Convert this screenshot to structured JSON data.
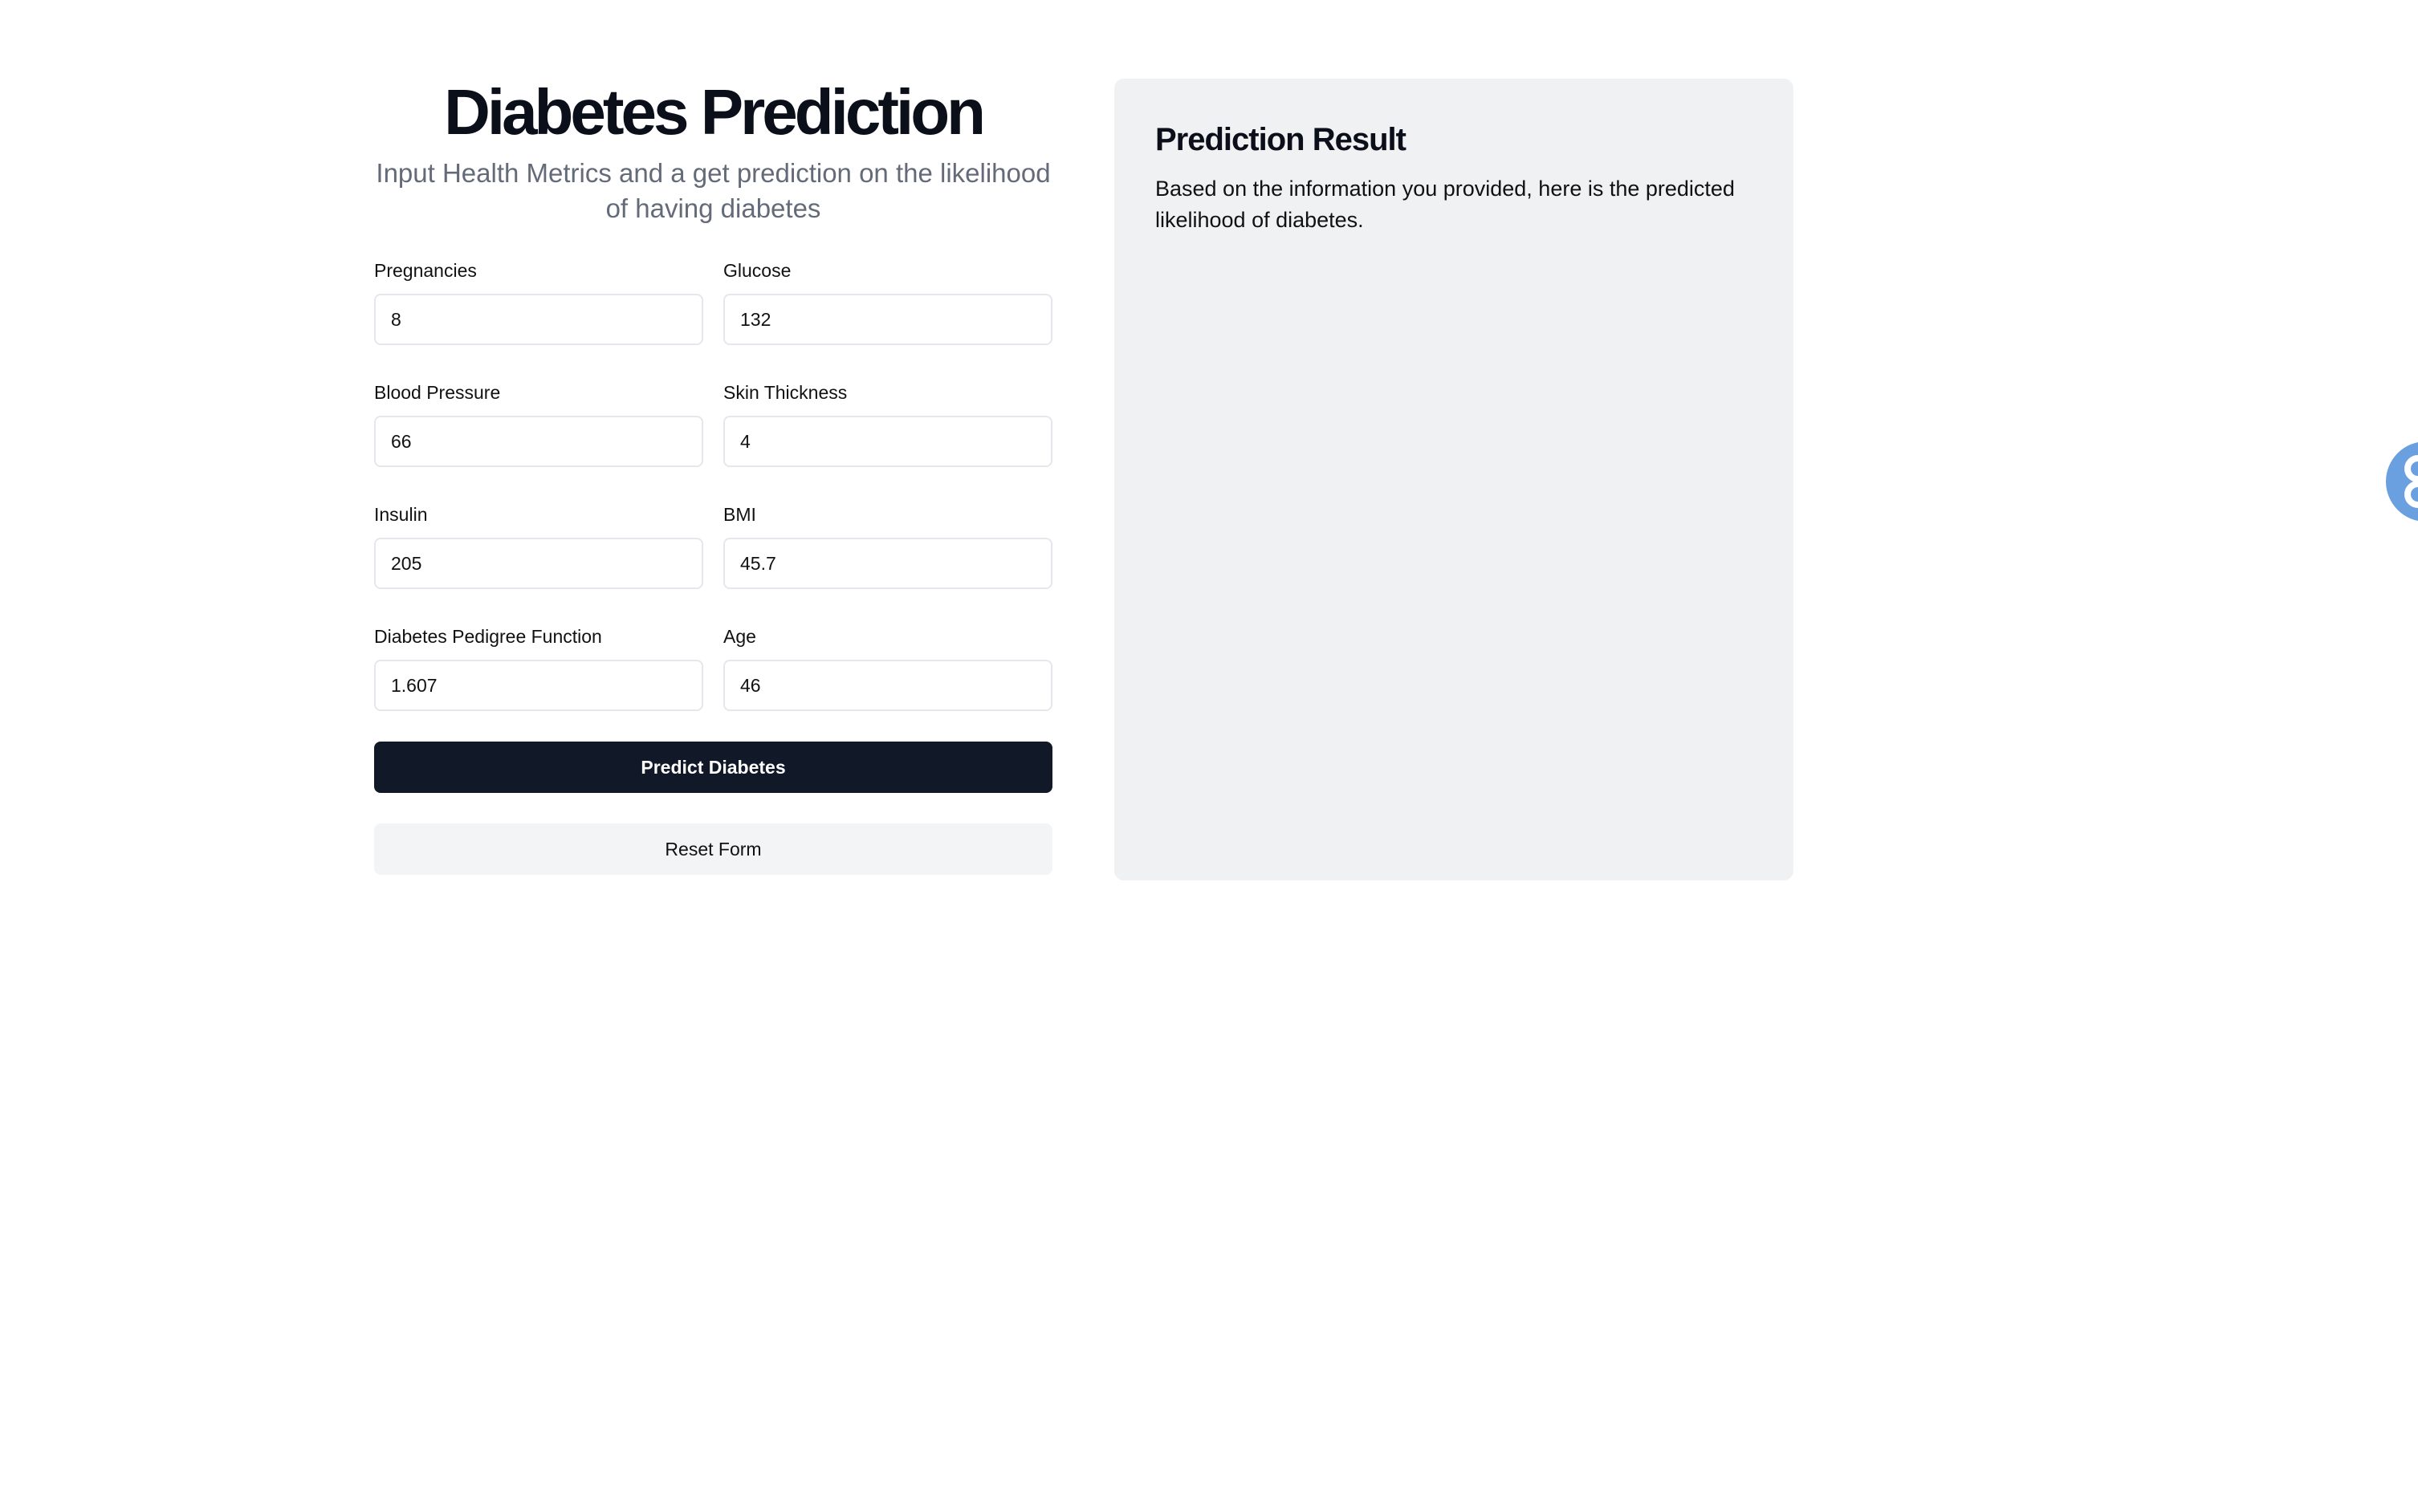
{
  "header": {
    "title": "Diabetes Prediction",
    "subtitle": "Input Health Metrics and a get prediction on the likelihood of having diabetes"
  },
  "form": {
    "fields": [
      {
        "label": "Pregnancies",
        "value": "8"
      },
      {
        "label": "Glucose",
        "value": "132"
      },
      {
        "label": "Blood Pressure",
        "value": "66"
      },
      {
        "label": "Skin Thickness",
        "value": "4"
      },
      {
        "label": "Insulin",
        "value": "205"
      },
      {
        "label": "BMI",
        "value": "45.7"
      },
      {
        "label": "Diabetes Pedigree Function",
        "value": "1.607"
      },
      {
        "label": "Age",
        "value": "46"
      }
    ],
    "predict_label": "Predict Diabetes",
    "reset_label": "Reset Form"
  },
  "result": {
    "title": "Prediction Result",
    "description": "Based on the information you provided, here is the predicted likelihood of diabetes."
  },
  "floating_widget": {
    "icon": "accessibility-icon",
    "color": "#6aa0e0"
  },
  "colors": {
    "primary_button": "#111827",
    "panel_background": "#f0f1f3",
    "subtitle_text": "#646b78"
  }
}
